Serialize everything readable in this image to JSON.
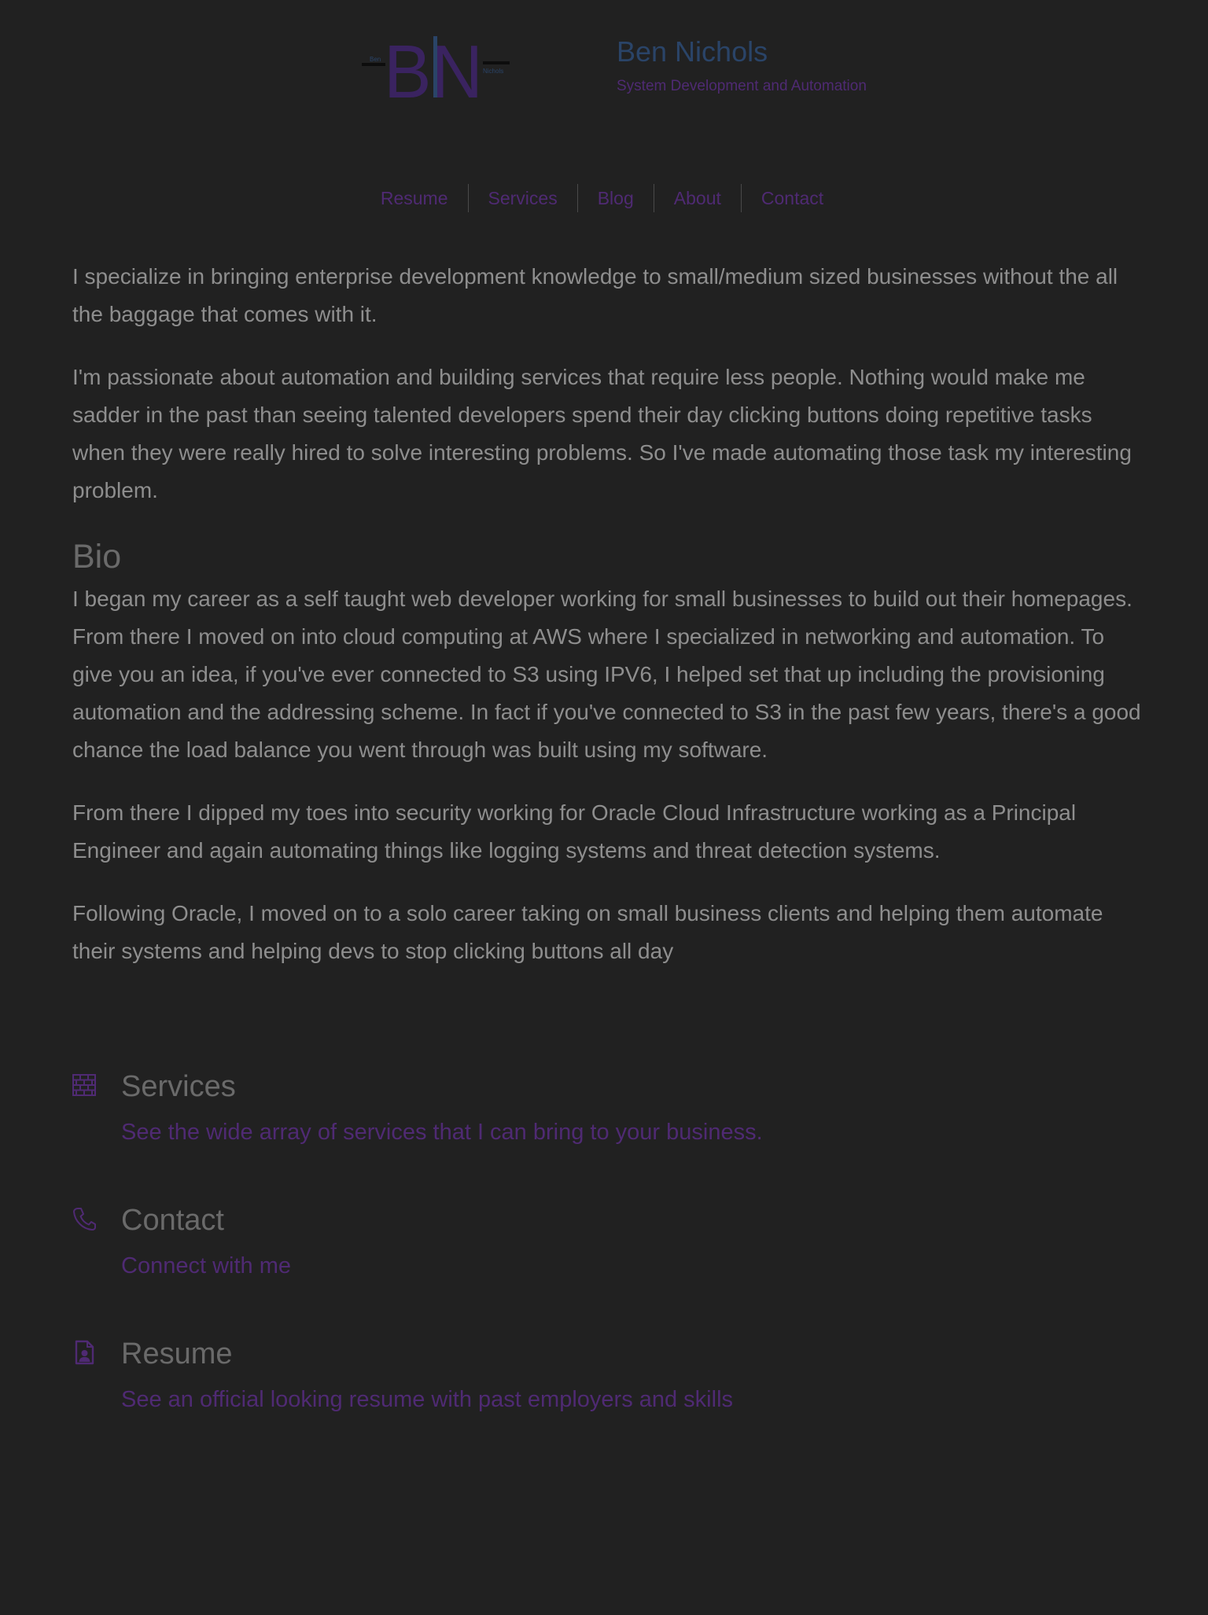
{
  "header": {
    "logo": {
      "icon": "bn-monogram-logo",
      "text_left": "Ben",
      "text_right": "Nichols",
      "letters": "BN"
    },
    "title": "Ben Nichols",
    "subtitle": "System Development and Automation"
  },
  "nav": {
    "items": [
      {
        "label": "Resume"
      },
      {
        "label": "Services"
      },
      {
        "label": "Blog"
      },
      {
        "label": "About"
      },
      {
        "label": "Contact"
      }
    ]
  },
  "intro": {
    "p1": "I specialize in bringing enterprise development knowledge to small/medium sized businesses without the all the baggage that comes with it.",
    "p2": "I'm passionate about automation and building services that require less people. Nothing would make me sadder in the past than seeing talented developers spend their day clicking buttons doing repetitive tasks when they were really hired to solve interesting problems. So I've made automating those task my interesting problem."
  },
  "bio": {
    "heading": "Bio",
    "p1": "I began my career as a self taught web developer working for small businesses to build out their homepages. From there I moved on into cloud computing at AWS where I specialized in networking and automation. To give you an idea, if you've ever connected to S3 using IPV6, I helped set that up including the provisioning automation and the addressing scheme. In fact if you've connected to S3 in the past few years, there's a good chance the load balance you went through was built using my software.",
    "p2": "From there I dipped my toes into security working for Oracle Cloud Infrastructure working as a Principal Engineer and again automating things like logging systems and threat detection systems.",
    "p3": "Following Oracle, I moved on to a solo career taking on small business clients and helping them automate their systems and helping devs to stop clicking buttons all day"
  },
  "features": [
    {
      "icon": "brick-wall-icon",
      "title": "Services",
      "link": "See the wide array of services that I can bring to your business."
    },
    {
      "icon": "phone-icon",
      "title": "Contact",
      "link": "Connect with me"
    },
    {
      "icon": "resume-document-icon",
      "title": "Resume",
      "link": "See an official looking resume with past employers and skills"
    }
  ],
  "colors": {
    "background": "#212121",
    "accent": "#4f2a73",
    "title": "#2a4468",
    "body_text": "#8e8e8e",
    "heading": "#6a6a6a"
  }
}
